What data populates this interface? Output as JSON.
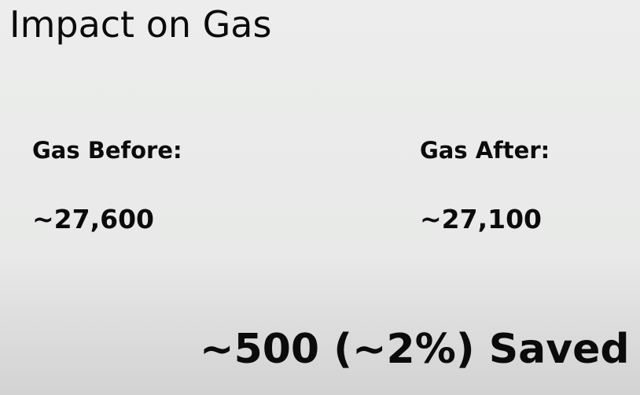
{
  "slide": {
    "title": "Impact on Gas",
    "before": {
      "label": "Gas Before:",
      "value": "~27,600"
    },
    "after": {
      "label": "Gas After:",
      "value": "~27,100"
    },
    "saved": "~500 (~2%) Saved"
  }
}
